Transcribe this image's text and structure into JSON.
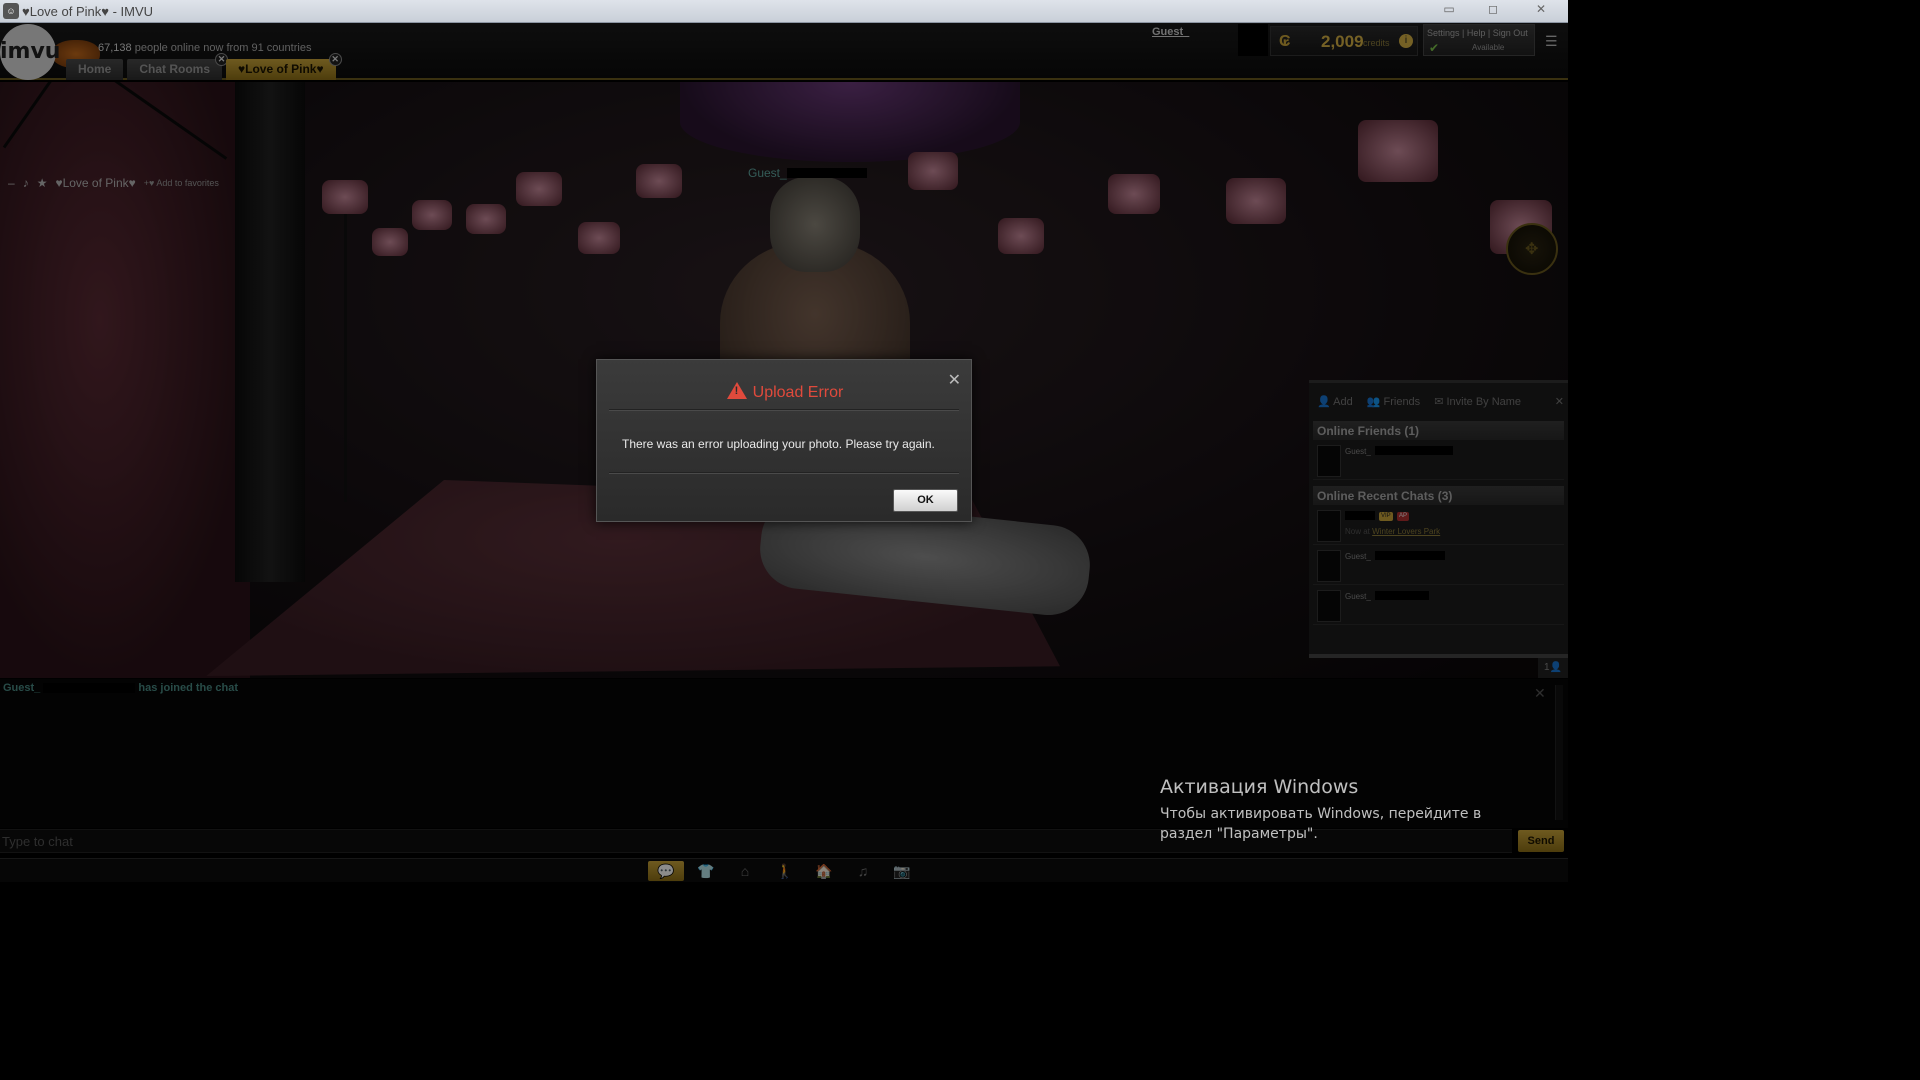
{
  "window": {
    "title": "♥Love of Pink♥ - IMVU",
    "minimize": "▭",
    "restore": "◻",
    "close": "✕"
  },
  "topbar": {
    "logo": "imvu",
    "online_count": "67,138",
    "online_text": "people online now from 91 countries",
    "tabs": [
      {
        "label": "Home"
      },
      {
        "label": "Chat Rooms"
      },
      {
        "label": "♥Love of Pink♥"
      }
    ],
    "guest_name": "Guest_",
    "credits_amount": "2,009",
    "credits_label": "credits",
    "user_links": "Settings | Help | Sign Out",
    "status": "Available"
  },
  "room": {
    "name": "♥Love of Pink♥",
    "add_favorites": "Add to favorites",
    "avatar_tag": "Guest_"
  },
  "friends_panel": {
    "add": "Add",
    "friends": "Friends",
    "invite": "Invite By Name",
    "online_friends_title": "Online Friends (1)",
    "online_friends": [
      {
        "name": "Guest_"
      }
    ],
    "recent_chats_title": "Online Recent Chats (3)",
    "recent_chats": [
      {
        "name": "",
        "location_prefix": "Now at",
        "location": "Winter Lovers Park",
        "badges": [
          "VIP",
          "AP"
        ]
      },
      {
        "name": "Guest_"
      },
      {
        "name": "Guest_"
      }
    ]
  },
  "chat": {
    "join_user": "Guest_",
    "join_text": "has joined the chat",
    "input_placeholder": "Type to chat",
    "send_label": "Send"
  },
  "modal": {
    "title": "Upload Error",
    "message": "There was an error uploading your photo. Please try again.",
    "ok_label": "OK"
  },
  "watermark": {
    "title": "Активация Windows",
    "subtitle": "Чтобы активировать Windows, перейдите в раздел \"Параметры\"."
  },
  "colors": {
    "accent": "#c9a43a",
    "error": "#e04a3c",
    "chat_user": "#4a8a84"
  }
}
